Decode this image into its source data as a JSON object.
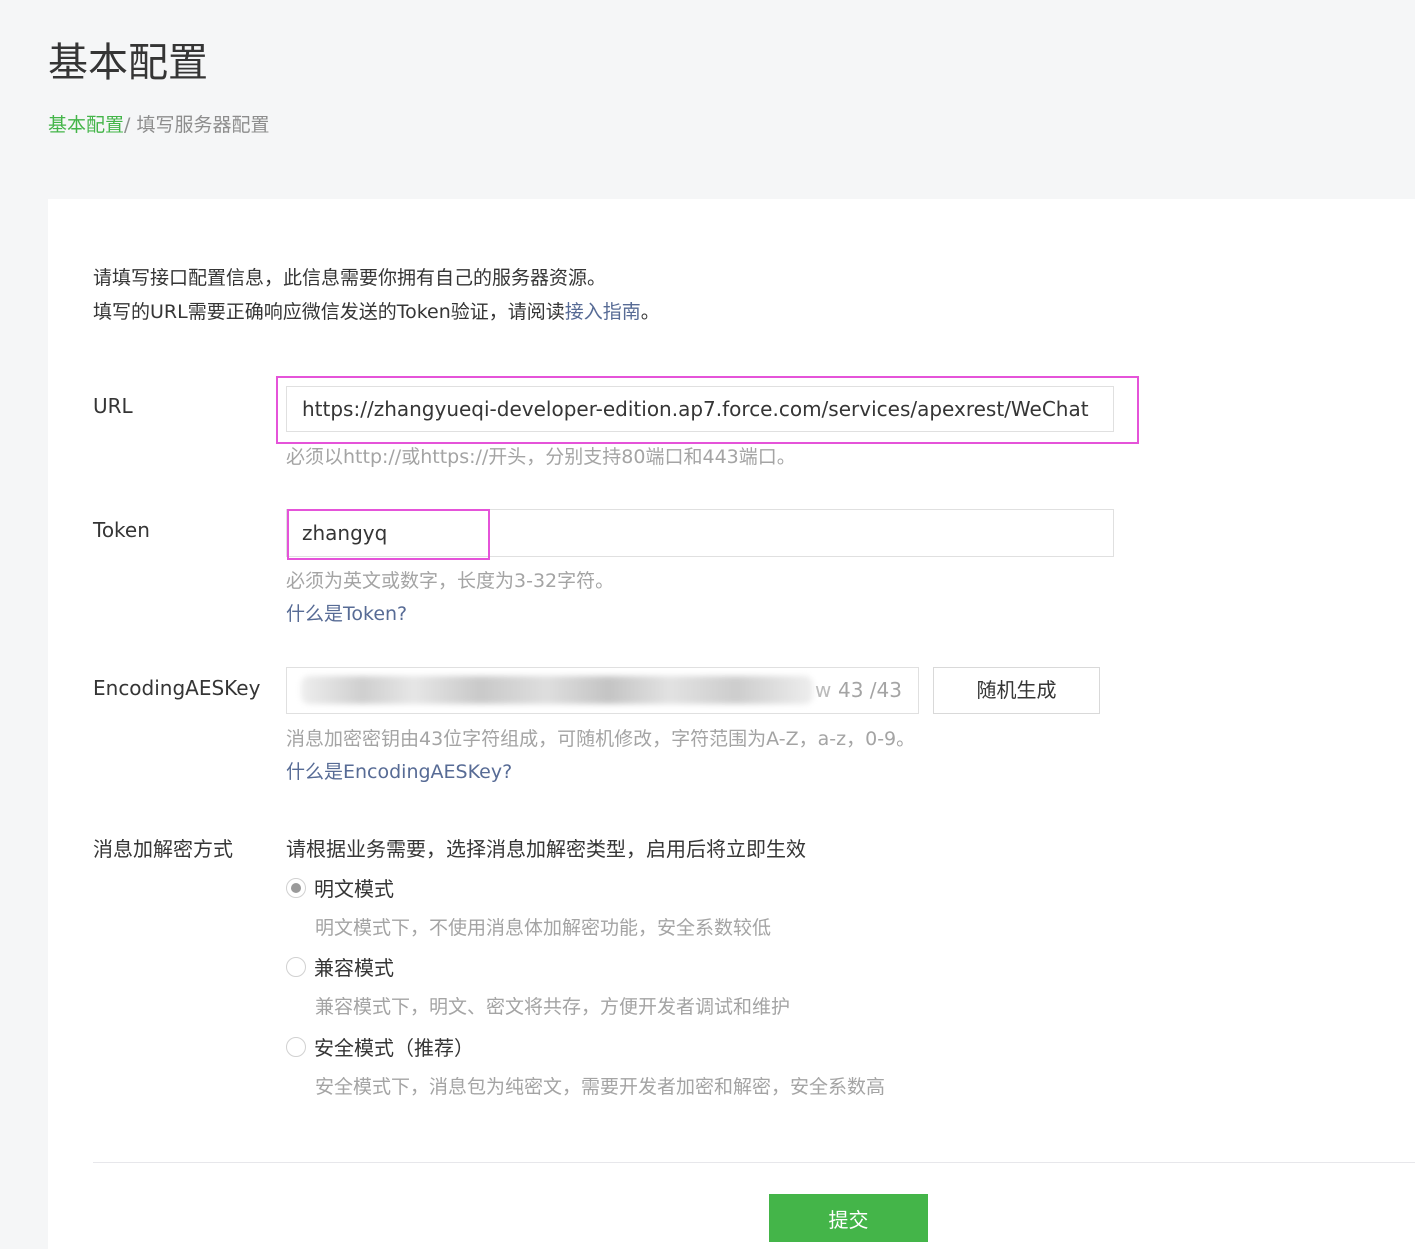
{
  "header": {
    "title": "基本配置",
    "breadcrumb": {
      "link": "基本配置",
      "separator": "/ ",
      "current": "填写服务器配置"
    }
  },
  "intro": {
    "line1": "请填写接口配置信息，此信息需要你拥有自己的服务器资源。",
    "line2_prefix": "填写的URL需要正确响应微信发送的Token验证，请阅读",
    "line2_link": "接入指南",
    "line2_suffix": "。"
  },
  "url": {
    "label": "URL",
    "value": "https://zhangyueqi-developer-edition.ap7.force.com/services/apexrest/WeChat",
    "hint": "必须以http://或https://开头，分别支持80端口和443端口。"
  },
  "token": {
    "label": "Token",
    "value": "zhangyq",
    "hint": "必须为英文或数字，长度为3-32字符。",
    "help_link": "什么是Token?"
  },
  "aes": {
    "label": "EncodingAESKey",
    "tail": "w",
    "counter": "43 /43",
    "generate_button": "随机生成",
    "hint": "消息加密密钥由43位字符组成，可随机修改，字符范围为A-Z，a-z，0-9。",
    "help_link": "什么是EncodingAESKey?"
  },
  "encryption": {
    "label": "消息加解密方式",
    "instruction": "请根据业务需要，选择消息加解密类型，启用后将立即生效",
    "options": [
      {
        "label": "明文模式",
        "description": "明文模式下，不使用消息体加解密功能，安全系数较低",
        "checked": true
      },
      {
        "label": "兼容模式",
        "description": "兼容模式下，明文、密文将共存，方便开发者调试和维护",
        "checked": false
      },
      {
        "label": "安全模式（推荐）",
        "description": "安全模式下，消息包为纯密文，需要开发者加密和解密，安全系数高",
        "checked": false
      }
    ]
  },
  "submit_label": "提交",
  "colors": {
    "accent": "#44b549",
    "link": "#576b95",
    "highlight": "#e553d9"
  }
}
